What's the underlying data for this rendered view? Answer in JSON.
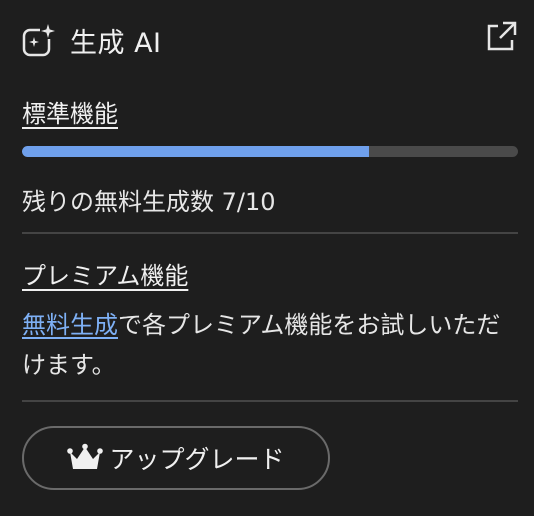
{
  "header": {
    "title": "生成 AI",
    "icon": "ai-sparkle-icon",
    "external_icon": "open-external-icon"
  },
  "standard": {
    "title": "標準機能",
    "progress_fraction": 0.7,
    "progress_color": "#6fa0ec",
    "remaining_text": "残りの無料生成数 7/10"
  },
  "premium": {
    "title": "プレミアム機能",
    "link_text": "無料生成",
    "desc_text": "で各プレミアム機能をお試しいただけます。",
    "link_color": "#7eb0f5"
  },
  "upgrade": {
    "label": "アップグレード",
    "icon": "crown-icon"
  }
}
